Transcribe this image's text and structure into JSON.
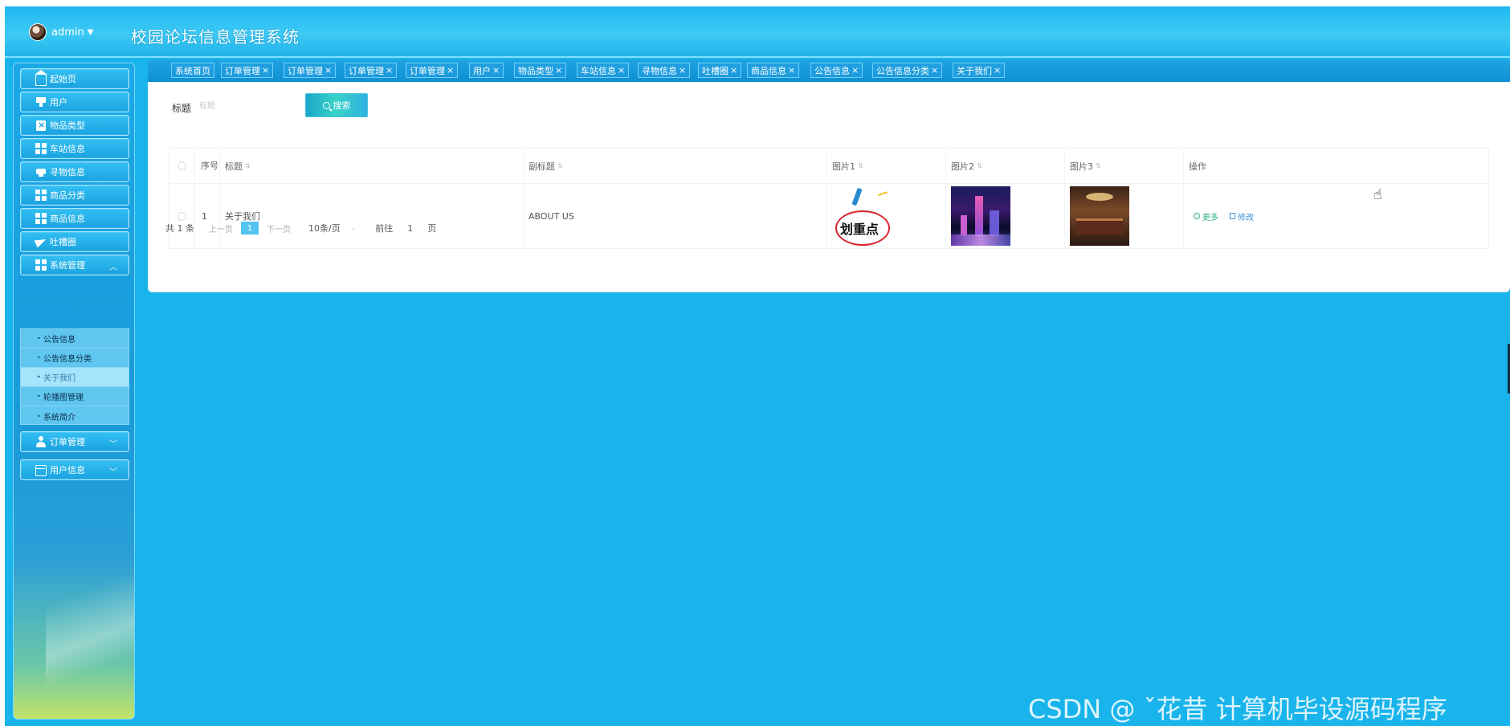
{
  "header": {
    "username": "admin",
    "caret": "▼",
    "app_title": "校园论坛信息管理系统"
  },
  "sidebar": {
    "items": [
      {
        "label": "起始页",
        "icon": "home-icon"
      },
      {
        "label": "用户",
        "icon": "user-card-icon"
      },
      {
        "label": "物品类型",
        "icon": "clipboard-icon"
      },
      {
        "label": "车站信息",
        "icon": "grid-icon"
      },
      {
        "label": "寻物信息",
        "icon": "printer-icon"
      },
      {
        "label": "商品分类",
        "icon": "grid-icon"
      },
      {
        "label": "商品信息",
        "icon": "grid-icon"
      },
      {
        "label": "吐槽圈",
        "icon": "paper-plane-icon"
      },
      {
        "label": "系统管理",
        "icon": "grid-icon",
        "expanded": true
      },
      {
        "label": "订单管理",
        "icon": "person-icon"
      },
      {
        "label": "用户信息",
        "icon": "card-icon"
      }
    ],
    "submenu": [
      {
        "label": "公告信息"
      },
      {
        "label": "公告信息分类"
      },
      {
        "label": "关于我们",
        "active": true
      },
      {
        "label": "轮播图管理"
      },
      {
        "label": "系统简介"
      }
    ]
  },
  "tabs": [
    {
      "label": "系统首页",
      "closable": false
    },
    {
      "label": "订单管理",
      "closable": true
    },
    {
      "label": "订单管理",
      "closable": true
    },
    {
      "label": "订单管理",
      "closable": true
    },
    {
      "label": "订单管理",
      "closable": true
    },
    {
      "label": "用户",
      "closable": true
    },
    {
      "label": "物品类型",
      "closable": true
    },
    {
      "label": "车站信息",
      "closable": true
    },
    {
      "label": "寻物信息",
      "closable": true
    },
    {
      "label": "吐槽圈",
      "closable": true
    },
    {
      "label": "商品信息",
      "closable": true
    },
    {
      "label": "公告信息",
      "closable": true
    },
    {
      "label": "公告信息分类",
      "closable": true
    },
    {
      "label": "关于我们",
      "closable": true
    }
  ],
  "tab_close": "×",
  "search": {
    "label": "标题",
    "placeholder": "标题",
    "button_label": "搜索"
  },
  "table": {
    "headers": [
      "序号",
      "标题",
      "副标题",
      "图片1",
      "图片2",
      "图片3",
      "操作"
    ],
    "sort_glyph": "⇅",
    "rows": [
      {
        "index": "1",
        "title": "关于我们",
        "subtitle": "ABOUT US",
        "image1_text": "划重点",
        "actions": [
          "更多",
          "修改"
        ]
      }
    ]
  },
  "pagination": {
    "total": "共 1 条",
    "prev": "上一页",
    "current": "1",
    "next": "下一页",
    "page_size": "10条/页",
    "goto_label": "前往",
    "goto_value": "1",
    "goto_unit": "页"
  },
  "watermark": "CSDN @ ˇ花昔  计算机毕设源码程序",
  "colors": {
    "background": "#19b4ec",
    "accent": "#53c3f0",
    "more_action": "#2db07f",
    "edit_action": "#3a90d8"
  }
}
